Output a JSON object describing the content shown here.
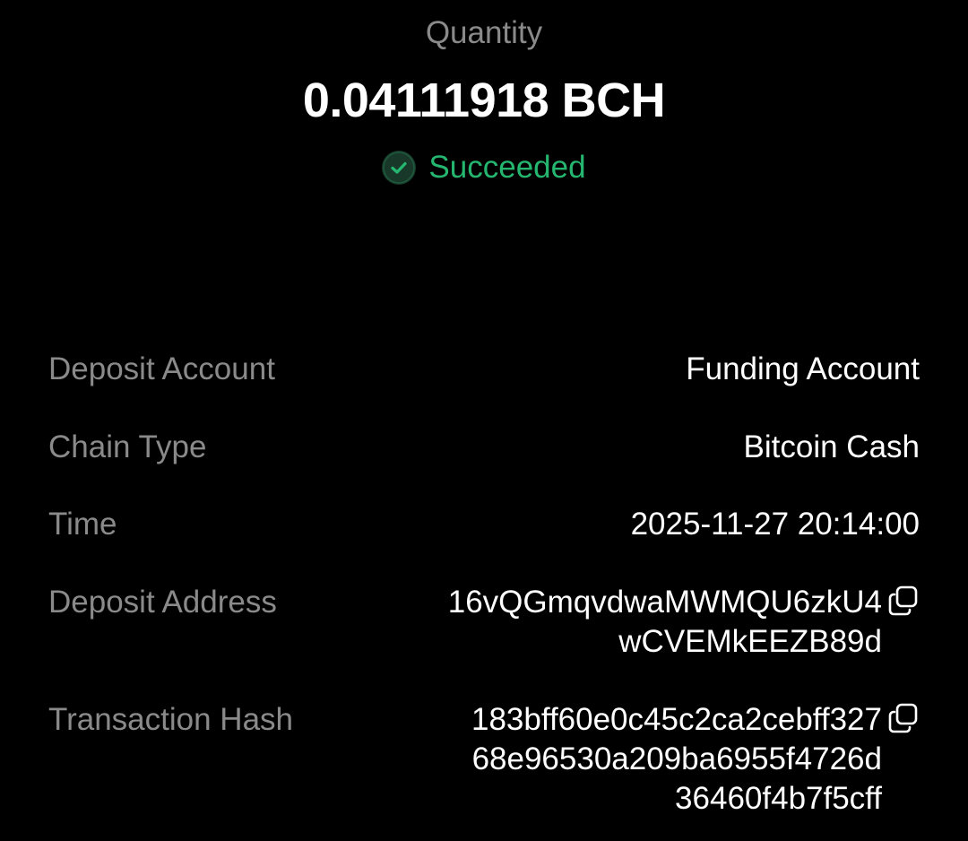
{
  "summary": {
    "quantity_label": "Quantity",
    "quantity_value": "0.04111918 BCH",
    "status": "Succeeded",
    "status_icon": "check-circle-icon",
    "status_color": "#25b770"
  },
  "details": {
    "deposit_account": {
      "label": "Deposit Account",
      "value": "Funding Account"
    },
    "chain_type": {
      "label": "Chain Type",
      "value": "Bitcoin Cash"
    },
    "time": {
      "label": "Time",
      "value": "2025-11-27 20:14:00"
    },
    "deposit_address": {
      "label": "Deposit Address",
      "lines": [
        "16vQGmqvdwaMWMQU6zkU4",
        "wCVEMkEEZB89d"
      ],
      "action_icon": "copy-icon"
    },
    "transaction_hash": {
      "label": "Transaction Hash",
      "lines": [
        "183bff60e0c45c2ca2cebff327",
        "68e96530a209ba6955f4726d",
        "36460f4b7f5cff"
      ],
      "action_icon": "copy-icon"
    }
  },
  "colors": {
    "background": "#000000",
    "label": "#8a8a8a",
    "value": "#ffffff",
    "success": "#25b770"
  }
}
